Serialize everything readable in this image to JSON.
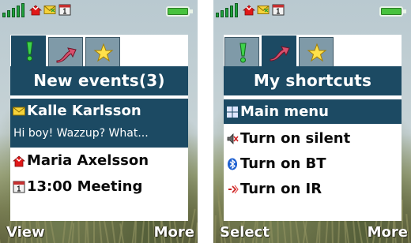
{
  "left_screen": {
    "title": "New events(3)",
    "events": [
      {
        "name": "Kalle Karlsson",
        "preview": "Hi boy! Wazzup? What...",
        "icon": "envelope-icon"
      },
      {
        "name": "Maria Axelsson",
        "icon": "missed-call-icon"
      },
      {
        "name": "13:00 Meeting",
        "icon": "calendar-icon"
      }
    ],
    "softkeys": {
      "left": "View",
      "right": "More"
    }
  },
  "right_screen": {
    "title": "My shortcuts",
    "shortcuts": [
      {
        "label": "Main menu",
        "icon": "main-menu-icon"
      },
      {
        "label": "Turn on silent",
        "icon": "silent-icon"
      },
      {
        "label": "Turn on BT",
        "icon": "bluetooth-icon"
      },
      {
        "label": "Turn on IR",
        "icon": "infrared-icon"
      }
    ],
    "softkeys": {
      "left": "Select",
      "right": "More"
    }
  },
  "tabs": [
    {
      "icon": "exclamation-icon"
    },
    {
      "icon": "shortcut-arrow-icon"
    },
    {
      "icon": "star-icon"
    }
  ],
  "status_bar": {
    "icons": [
      "signal-icon",
      "missed-call-icon",
      "message-icon",
      "calendar-icon",
      "battery-icon"
    ]
  },
  "colors": {
    "selection": "#1c4a63",
    "tab_inactive": "#7f9aa8",
    "battery": "#47c23e",
    "signal": "#1fa13c"
  }
}
